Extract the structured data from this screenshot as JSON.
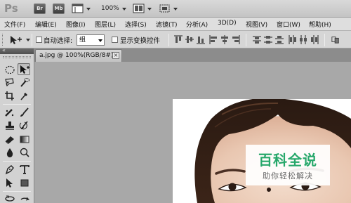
{
  "app": {
    "logo": "Ps",
    "bridge_button": "Br",
    "minibridge_button": "Mb",
    "zoom_level": "100%"
  },
  "menu": {
    "items": [
      "文件(F)",
      "编辑(E)",
      "图像(I)",
      "图层(L)",
      "选择(S)",
      "滤镜(T)",
      "分析(A)",
      "3D(D)",
      "视图(V)",
      "窗口(W)",
      "帮助(H)"
    ]
  },
  "options": {
    "auto_select_label": "自动选择:",
    "auto_select_checked": false,
    "auto_select_value": "组",
    "show_transform_label": "显示变换控件",
    "show_transform_checked": false
  },
  "document": {
    "tab_title": "a.jpg @ 100%(RGB/8#)",
    "close_glyph": "×"
  },
  "watermark": {
    "title": "百科全说",
    "subtitle": "助你轻松解决",
    "color": "#27a86b"
  },
  "icons": [
    "launch-bridge-icon",
    "mini-bridge-icon",
    "view-extras-icon",
    "arrange-documents-icon",
    "screen-mode-icon",
    "move-tool-icon",
    "marquee-tool-icon",
    "lasso-tool-icon",
    "quick-selection-tool-icon",
    "crop-tool-icon",
    "eyedropper-tool-icon",
    "spot-healing-tool-icon",
    "brush-tool-icon",
    "clone-stamp-tool-icon",
    "history-brush-tool-icon",
    "eraser-tool-icon",
    "gradient-tool-icon",
    "blur-tool-icon",
    "dodge-tool-icon",
    "pen-tool-icon",
    "type-tool-icon",
    "path-selection-tool-icon",
    "shape-tool-icon",
    "3d-rotate-tool-icon",
    "3d-orbit-tool-icon"
  ]
}
